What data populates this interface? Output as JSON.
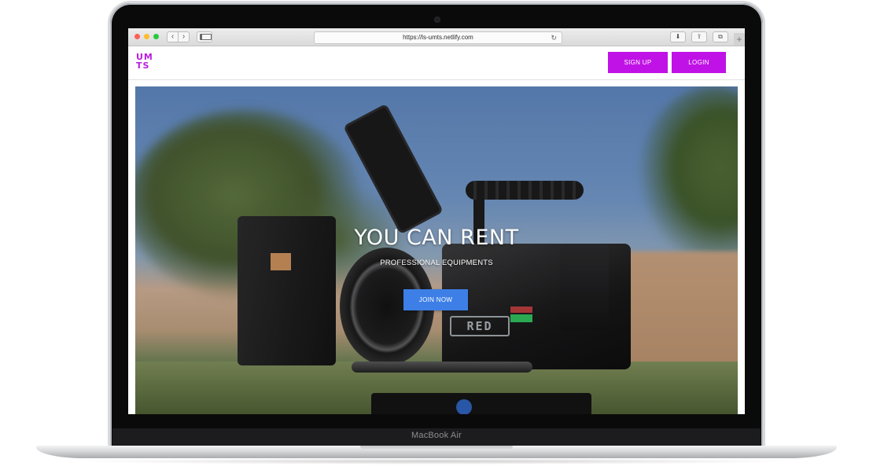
{
  "device": {
    "model_label": "MacBook Air"
  },
  "browser": {
    "url": "https://ls-umts.netlify.com",
    "new_tab_icon": "+",
    "colors": {
      "close": "#fc5f57",
      "minimize": "#fdbc2e",
      "maximize": "#29c941"
    }
  },
  "site": {
    "logo": {
      "line1": "UM",
      "line2": "TS",
      "color": "#b91ce0"
    },
    "header": {
      "signup_label": "SIGN UP",
      "login_label": "LOGIN",
      "button_color": "#c012e6"
    },
    "hero": {
      "title": "YOU CAN RENT",
      "subtitle": "PROFESSIONAL EQUIPMENTS",
      "cta_label": "JOIN NOW",
      "cta_color": "#3d7fe6",
      "camera_brand": "RED"
    }
  }
}
